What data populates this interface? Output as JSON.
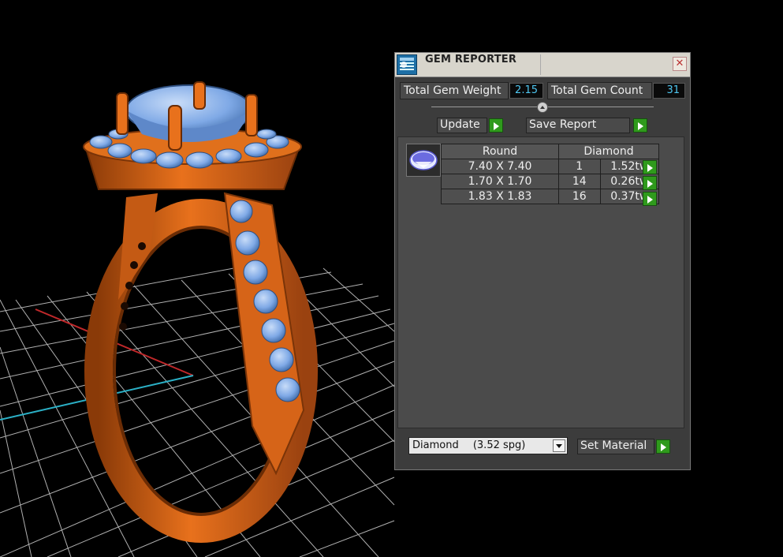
{
  "panel": {
    "title": "GEM REPORTER",
    "close_glyph": "✕",
    "total_weight_label": "Total Gem Weight",
    "total_weight_value": "2.15",
    "total_count_label": "Total Gem Count",
    "total_count_value": "31",
    "update_label": "Update",
    "save_report_label": "Save Report",
    "table": {
      "headers": [
        "Round",
        "Diamond"
      ],
      "rows": [
        {
          "size": "7.40 X 7.40",
          "count": "1",
          "weight": "1.52tw"
        },
        {
          "size": "1.70 X 1.70",
          "count": "14",
          "weight": "0.26tw"
        },
        {
          "size": "1.83 X 1.83",
          "count": "16",
          "weight": "0.37tw"
        }
      ]
    },
    "material_select": {
      "name": "Diamond",
      "density": "(3.52 spg)"
    },
    "set_material_label": "Set Material"
  },
  "colors": {
    "metal": "#e8711c",
    "gem": "#7fa9e6",
    "grid": "#d9d9d9",
    "axis_x": "#c0282a",
    "axis_z": "#2bb0c6",
    "go_button": "#2f9a1c",
    "value_text": "#4ec6f0"
  },
  "icons": [
    "gem-reporter-app-icon",
    "close-icon",
    "play-arrow-icon",
    "dropdown-arrow-icon",
    "round-gem-thumbnail-icon"
  ]
}
